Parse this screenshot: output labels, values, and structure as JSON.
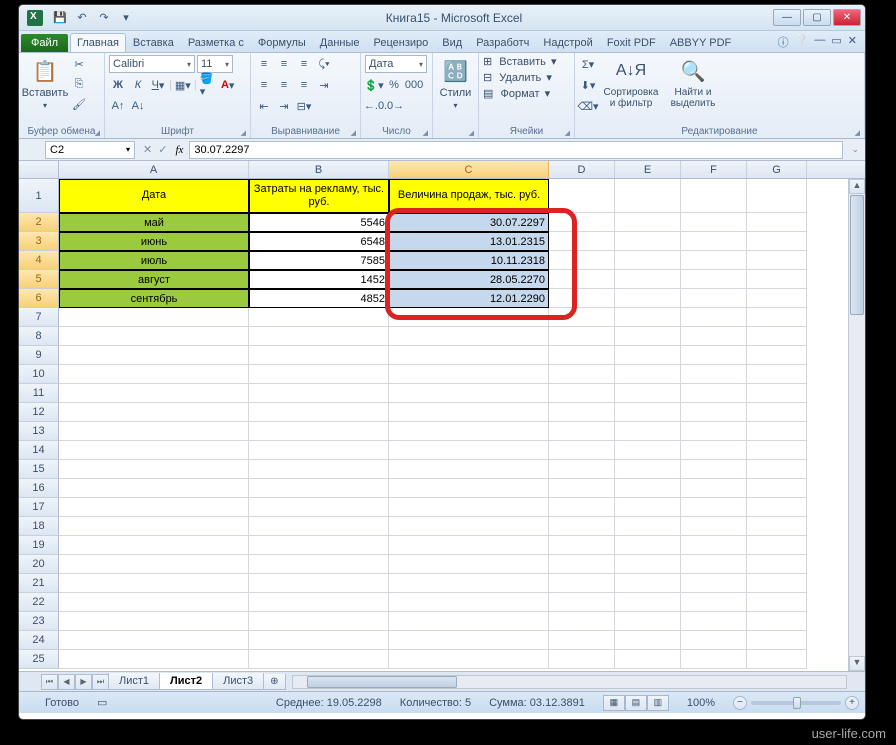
{
  "window": {
    "title": "Книга15 - Microsoft Excel"
  },
  "qat": {
    "save": "💾",
    "undo": "↶",
    "redo": "↷",
    "more": "▾"
  },
  "tabs": {
    "file": "Файл",
    "list": [
      "Главная",
      "Вставка",
      "Разметка с",
      "Формулы",
      "Данные",
      "Рецензиро",
      "Вид",
      "Разработч",
      "Надстрой",
      "Foxit PDF",
      "ABBYY PDF"
    ],
    "active_index": 0
  },
  "ribbon": {
    "clipboard": {
      "label": "Буфер обмена",
      "paste": "Вставить"
    },
    "font": {
      "label": "Шрифт",
      "name": "Calibri",
      "size": "11"
    },
    "align": {
      "label": "Выравнивание"
    },
    "number": {
      "label": "Число",
      "format": "Дата"
    },
    "styles": {
      "label": "Стили",
      "btn": "Стили"
    },
    "cells": {
      "label": "Ячейки",
      "insert": "Вставить",
      "delete": "Удалить",
      "format": "Формат"
    },
    "editing": {
      "label": "Редактирование",
      "sort": "Сортировка\nи фильтр",
      "find": "Найти и\nвыделить"
    }
  },
  "formula_bar": {
    "cell_ref": "C2",
    "formula": "30.07.2297"
  },
  "grid": {
    "columns": [
      "A",
      "B",
      "C",
      "D",
      "E",
      "F",
      "G"
    ],
    "selected_col": "C",
    "headers": {
      "A": "Дата",
      "B": "Затраты на рекламу, тыс. руб.",
      "C": "Величина продаж, тыс. руб."
    },
    "rows": [
      {
        "n": "2",
        "A": "май",
        "B": "5546",
        "C": "30.07.2297"
      },
      {
        "n": "3",
        "A": "июнь",
        "B": "6548",
        "C": "13.01.2315"
      },
      {
        "n": "4",
        "A": "июль",
        "B": "7585",
        "C": "10.11.2318"
      },
      {
        "n": "5",
        "A": "август",
        "B": "1452",
        "C": "28.05.2270"
      },
      {
        "n": "6",
        "A": "сентябрь",
        "B": "4852",
        "C": "12.01.2290"
      }
    ],
    "empty_rows": [
      "7",
      "8",
      "9",
      "10",
      "11",
      "12",
      "13",
      "14",
      "15",
      "16",
      "17",
      "18",
      "19",
      "20",
      "21",
      "22",
      "23",
      "24",
      "25"
    ]
  },
  "sheets": {
    "list": [
      "Лист1",
      "Лист2",
      "Лист3"
    ],
    "active_index": 1
  },
  "status": {
    "ready": "Готово",
    "avg_label": "Среднее:",
    "avg": "19.05.2298",
    "count_label": "Количество:",
    "count": "5",
    "sum_label": "Сумма:",
    "sum": "03.12.3891",
    "zoom": "100%"
  },
  "watermark": "user-life.com"
}
